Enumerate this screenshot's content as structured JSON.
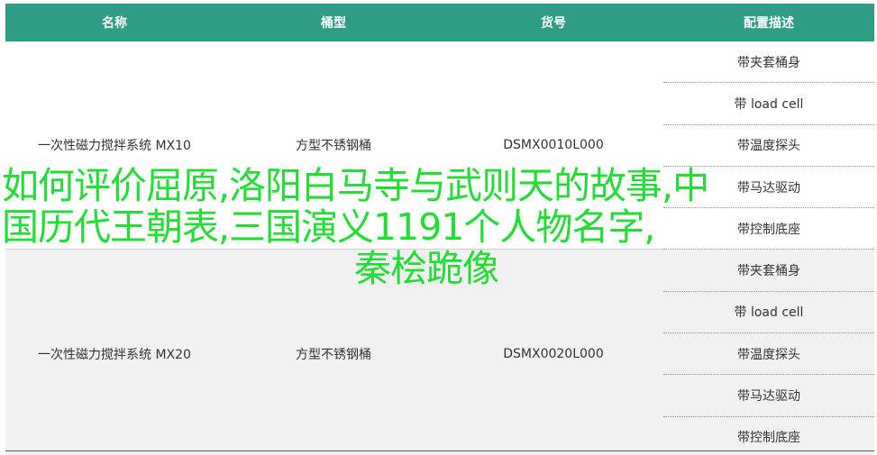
{
  "table": {
    "headers": [
      "名称",
      "桶型",
      "货号",
      "配置描述"
    ],
    "products": [
      {
        "name": "一次性磁力搅拌系统 MX10",
        "bucket": "方型不锈钢桶",
        "sku": "DSMX0010L000",
        "configs": [
          "带夹套桶身",
          "带 load cell",
          "带温度探头",
          "带马达驱动",
          "带控制底座"
        ]
      },
      {
        "name": "一次性磁力搅拌系统 MX20",
        "bucket": "方型不锈钢桶",
        "sku": "DSMX0020L000",
        "configs": [
          "带夹套桶身",
          "带 load cell",
          "带温度探头",
          "带马达驱动",
          "带控制底座"
        ]
      }
    ]
  },
  "overlay": {
    "line1": "如何评价屈原,洛阳白马寺与武则天的故事,中",
    "line2": "国历代王朝表,三国演义1191个人物名字,",
    "line3": "秦桧跪像"
  },
  "colors": {
    "header_bg": "#2f9c86",
    "header_text": "#ffffff",
    "overlay_text": "#22dd33",
    "alt_row_bg": "#f1f1f1"
  }
}
